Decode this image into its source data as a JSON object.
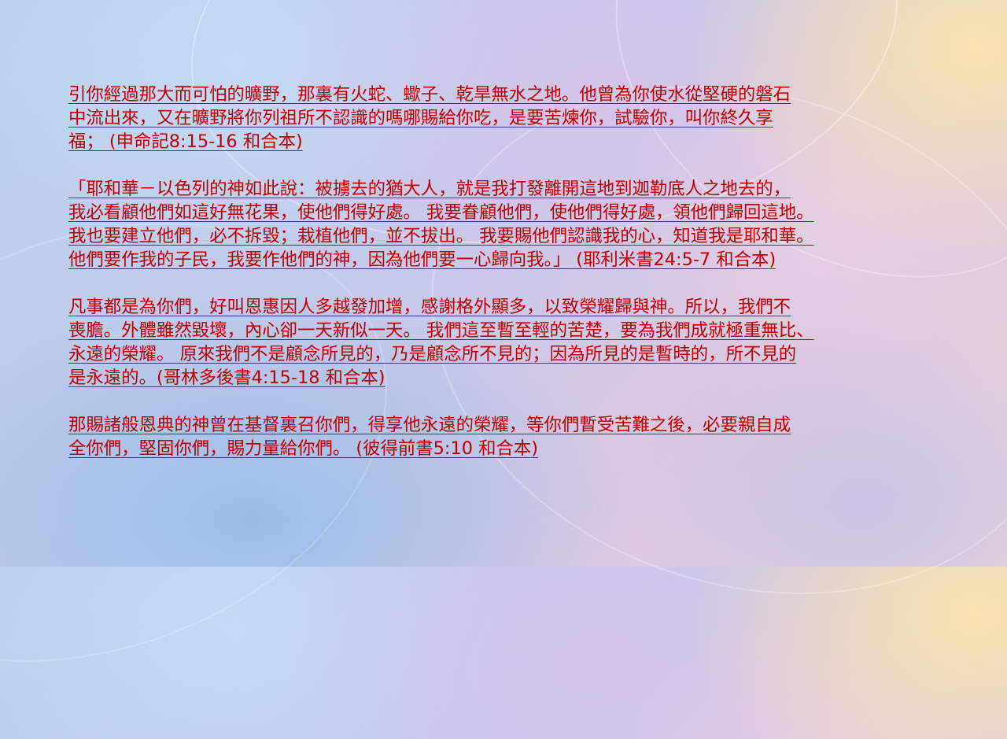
{
  "passages": [
    {
      "lines": [
        "引你經過那大而可怕的曠野，那裏有火蛇、蠍子、乾旱無水之地。他曾為你使水從堅硬的磐石",
        "中流出來，又在曠野將你列祖所不認識的嗎哪賜給你吃，是要苦煉你，試驗你，叫你終久享",
        "福；  (申命記8:15-16 和合本)"
      ]
    },
    {
      "lines": [
        "「耶和華－以色列的神如此說：被擄去的猶大人，就是我打發離開這地到迦勒底人之地去的，",
        "我必看顧他們如這好無花果，使他們得好處。 我要眷顧他們，使他們得好處，領他們歸回這地。",
        "我也要建立他們，必不拆毀；栽植他們，並不拔出。 我要賜他們認識我的心，知道我是耶和華。",
        "他們要作我的子民，我要作他們的神，因為他們要一心歸向我。」 (耶利米書24:5-7 和合本)"
      ]
    },
    {
      "lines": [
        "凡事都是為你們，好叫恩惠因人多越發加增，感謝格外顯多，以致榮耀歸與神。所以，我們不",
        "喪膽。外體雖然毀壞，內心卻一天新似一天。 我們這至暫至輕的苦楚，要為我們成就極重無比、",
        "永遠的榮耀。 原來我們不是顧念所見的，乃是顧念所不見的；因為所見的是暫時的，所不見的",
        "是永遠的。(哥林多後書4:15-18 和合本)"
      ]
    },
    {
      "lines": [
        "那賜諸般恩典的神曾在基督裏召你們，得享他永遠的榮耀，等你們暫受苦難之後，必要親自成",
        "全你們，堅固你們，賜力量給你們。 (彼得前書5:10 和合本)"
      ]
    }
  ],
  "colors": {
    "text": "#c00000"
  }
}
